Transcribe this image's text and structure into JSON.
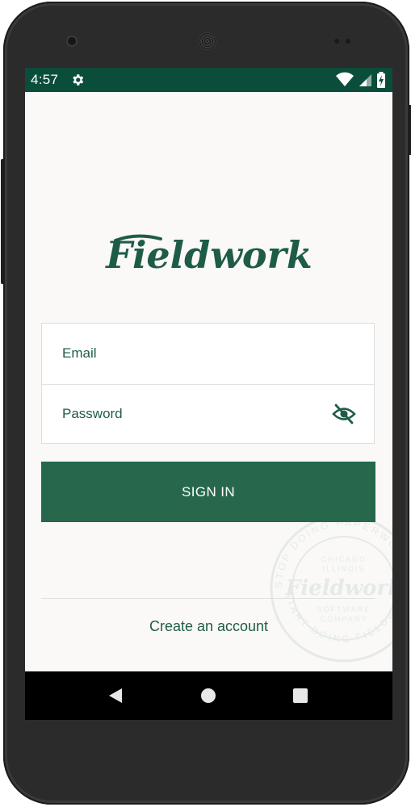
{
  "status_bar": {
    "time": "4:57",
    "icons": [
      "gear-icon",
      "wifi-icon",
      "cell-signal-icon",
      "battery-charging-icon"
    ]
  },
  "brand": {
    "logo_text": "Fieldwork",
    "color": "#1f5c48"
  },
  "login_form": {
    "email_label": "Email",
    "password_label": "Password",
    "password_toggle_icon": "eye-off-icon"
  },
  "actions": {
    "sign_in_label": "SIGN IN",
    "create_account_label": "Create an account"
  },
  "watermark": {
    "logo_text": "Fieldwork",
    "line1": "CHICAGO",
    "line2": "ILLINOIS",
    "line3": "SOFTWARE",
    "line4": "COMPANY",
    "ring_top": "STOP DOING PAPERWORK",
    "ring_bottom": "START DOING FIELDWORK"
  },
  "nav_bar": {
    "icons": [
      "back-icon",
      "home-icon",
      "recents-icon"
    ]
  },
  "colors": {
    "status_bar": "#0b4d3b",
    "primary_button": "#27684c",
    "screen_background": "#faf9f7"
  }
}
